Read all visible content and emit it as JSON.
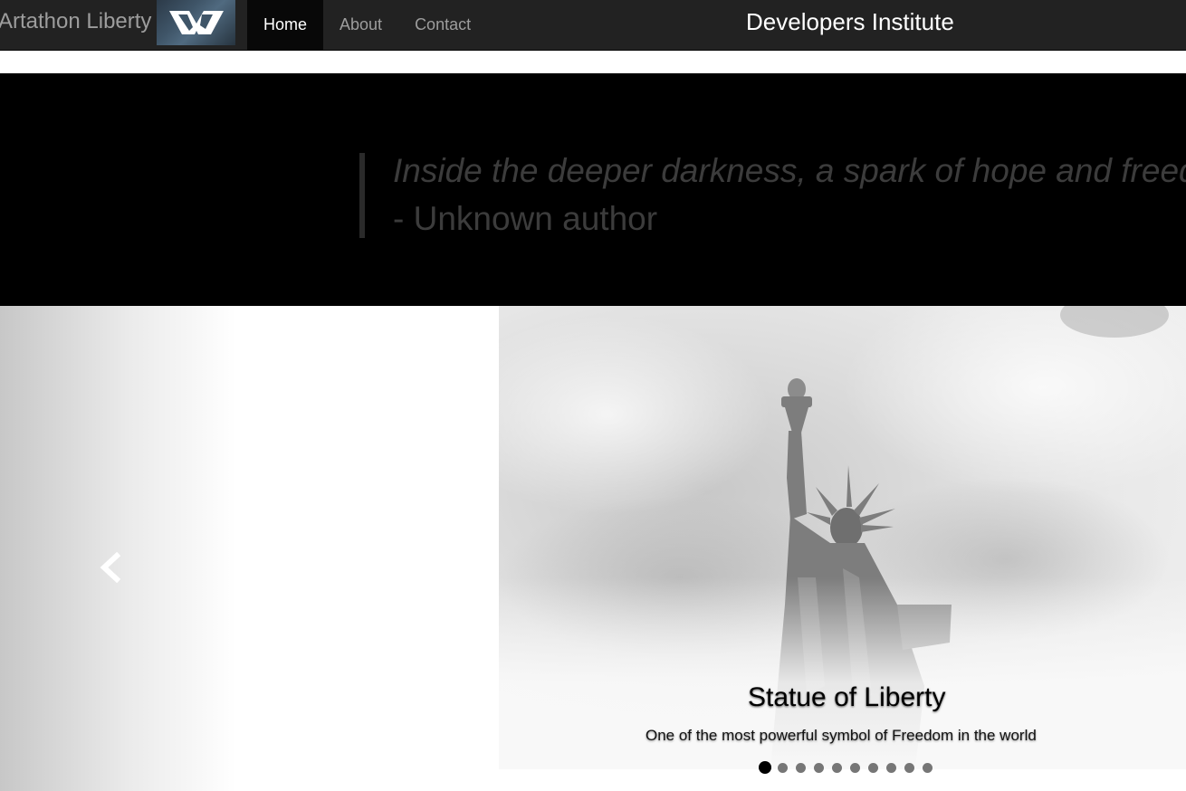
{
  "navbar": {
    "brand": "Artathon Liberty",
    "logo_icon": "dw-logo",
    "items": [
      {
        "label": "Home",
        "active": true
      },
      {
        "label": "About",
        "active": false
      },
      {
        "label": "Contact",
        "active": false
      }
    ],
    "center_title": "Developers Institute",
    "background": "#222222"
  },
  "quote": {
    "text": "Inside the deeper darkness, a spark of hope and freedom",
    "author": "- Unknown author",
    "background": "#000000",
    "text_color": "#3c3c3c"
  },
  "carousel": {
    "prev_icon": "chevron-left-icon",
    "slide": {
      "image": "statue-of-liberty-photo",
      "title": "Statue of Liberty",
      "subtitle": "One of the most powerful symbol of Freedom in the world"
    },
    "indicator_count": 10,
    "active_indicator": 1
  }
}
